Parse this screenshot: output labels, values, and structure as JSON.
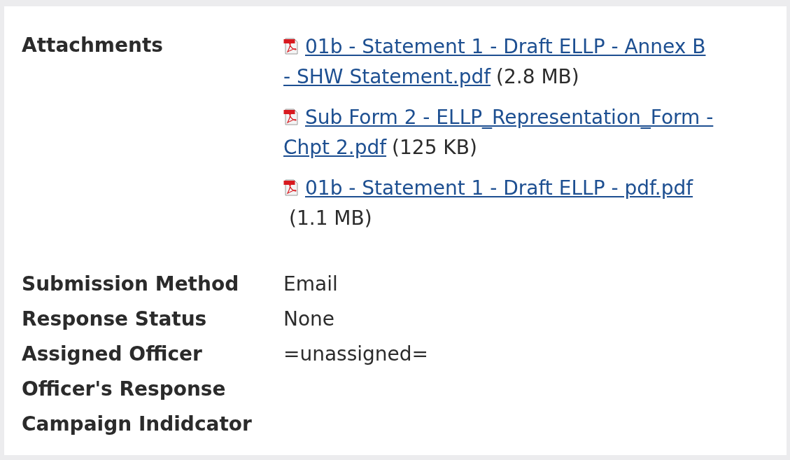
{
  "attachments": {
    "label": "Attachments",
    "files": [
      {
        "link_lines": [
          "01b - Statement 1 - Draft ELLP - Annex B",
          "- SHW Statement.pdf"
        ],
        "size": "(2.8 MB)"
      },
      {
        "link_lines": [
          "Sub Form 2 - ELLP_Representation_Form -",
          "Chpt 2.pdf"
        ],
        "size": "(125 KB)"
      },
      {
        "link_lines": [
          "01b - Statement 1 - Draft ELLP - pdf.pdf"
        ],
        "size": "(1.1 MB)"
      }
    ]
  },
  "fields": [
    {
      "label": "Submission Method",
      "value": "Email"
    },
    {
      "label": "Response Status",
      "value": "None"
    },
    {
      "label": "Assigned Officer",
      "value": "=unassigned="
    },
    {
      "label": "Officer's Response"
    },
    {
      "label": "Campaign Indidcator"
    }
  ]
}
